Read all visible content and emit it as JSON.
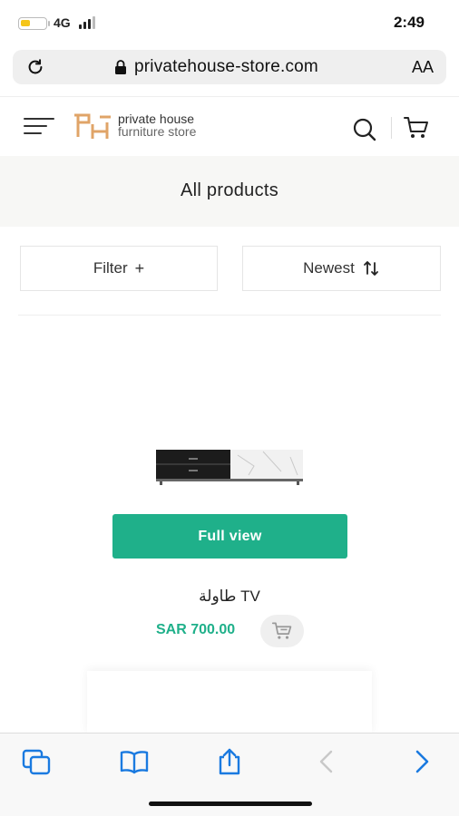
{
  "status_bar": {
    "network": "4G",
    "time": "2:49",
    "battery_level": 0.4
  },
  "browser": {
    "url": "privatehouse-store.com",
    "text_size_label": "AA",
    "icons": [
      "reload-icon",
      "lock-icon",
      "tabs-icon",
      "bookmarks-icon",
      "share-icon",
      "back-icon",
      "forward-icon"
    ]
  },
  "header": {
    "logo_line1": "private house",
    "logo_line2": "furniture store",
    "icons": [
      "menu-icon",
      "search-icon",
      "cart-icon"
    ]
  },
  "page": {
    "title": "All products",
    "filter_label": "Filter",
    "filter_symbol": "+",
    "sort_label": "Newest"
  },
  "product": {
    "full_view_label": "Full view",
    "name": "طاولة TV",
    "price": "SAR 700.00"
  },
  "colors": {
    "accent": "#1fb08a",
    "logo": "#e0a468",
    "battery": "#f5c518",
    "browser_blue": "#1a7ae0"
  }
}
